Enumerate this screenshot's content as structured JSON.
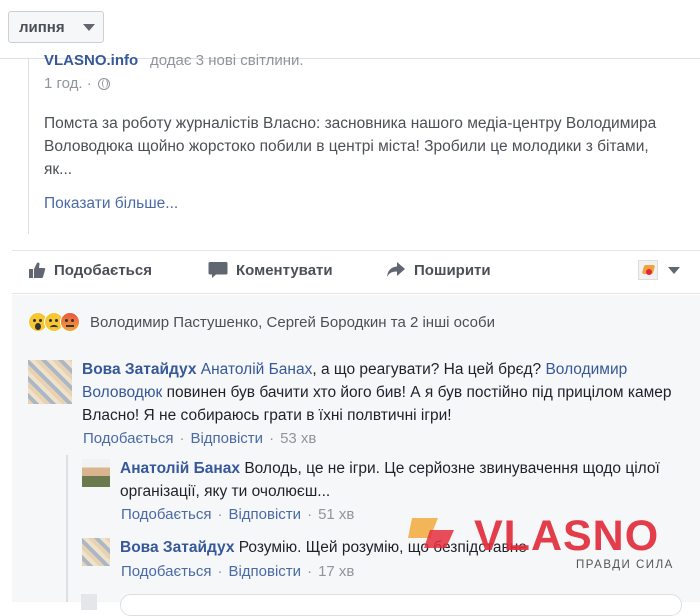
{
  "month_selector": {
    "label": "липня"
  },
  "post": {
    "page_name": "VLASNO.info",
    "added_text": "додає 3 нові світлини.",
    "time": "1 год. ·",
    "text_lines": [
      "Помста за роботу журналістів Власно: засновника нашого медіа-центру Володимира",
      "Воловодюка щойно жорстоко побили в центрі міста! Зробили це молодики з бітами,",
      "як..."
    ],
    "see_more": "Показати більше..."
  },
  "actions": {
    "like": "Подобається",
    "comment": "Коментувати",
    "share": "Поширити"
  },
  "reactions": {
    "names": "Володимир Пастушенко, Сергей Бородкин та 2 інші особи"
  },
  "comments": [
    {
      "author": "Вова Затайдух",
      "mention1": "Анатолій Банах",
      "text1": ", а що реагувати? На цей брєд?",
      "mention2": "Володимир Воловодюк",
      "text2": "повинен був бачити хто його бив! А я був постійно під прицілом камер Власно! Я не собираюсь грати в їхні полвтичні ігри!",
      "like": "Подобається",
      "reply": "Відповісти",
      "time": "53 хв"
    },
    {
      "author": "Анатолій Банах",
      "text": "Володь, це не ігри. Це серйозне звинувачення щодо цілої організації, яку ти очолюєш...",
      "like": "Подобається",
      "reply": "Відповісти",
      "time": "51 хв"
    },
    {
      "author": "Вова Затайдух",
      "text": "Розумію. Щей розумію, що безпідставне",
      "like": "Подобається",
      "reply": "Відповісти",
      "time": "17 хв"
    }
  ],
  "watermark": {
    "brand": "VLASNO",
    "tagline": "ПРАВДИ СИЛА"
  },
  "separator": "·"
}
